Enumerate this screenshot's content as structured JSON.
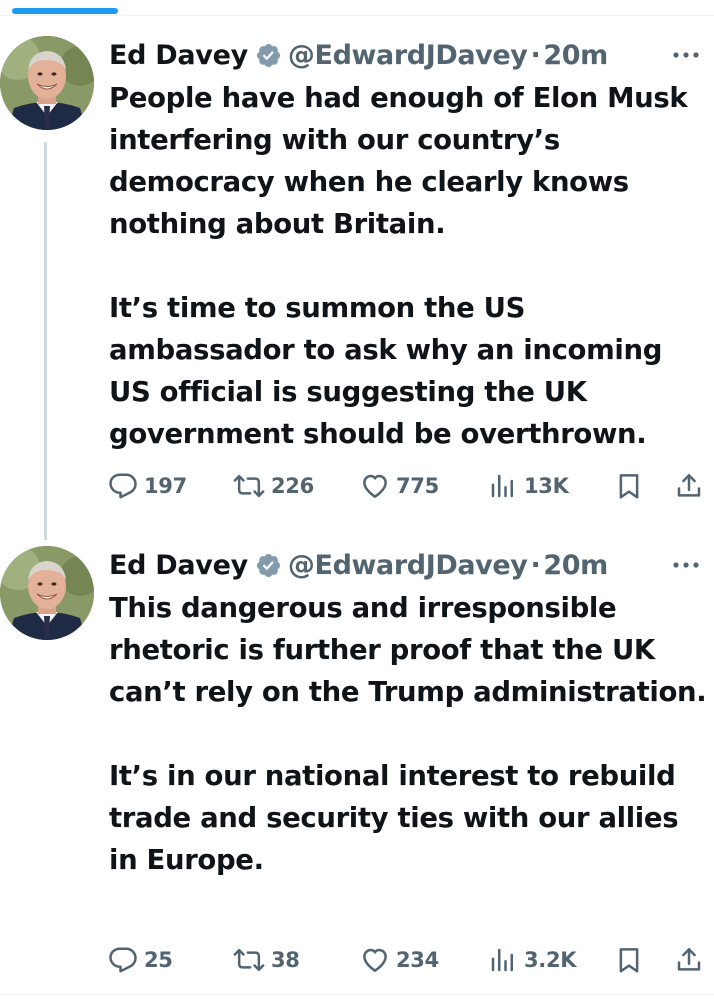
{
  "tweets": [
    {
      "author_name": "Ed Davey",
      "handle": "@EdwardJDavey",
      "separator": "·",
      "time": "20m",
      "paragraphs": [
        "People have had enough of Elon Musk interfering with our country’s democracy when he clearly knows nothing about Britain.",
        "It’s time to summon the US ambassador to ask why an incoming US official is suggesting the UK government should be overthrown."
      ],
      "stats": {
        "replies": "197",
        "reposts": "226",
        "likes": "775",
        "views": "13K"
      }
    },
    {
      "author_name": "Ed Davey",
      "handle": "@EdwardJDavey",
      "separator": "·",
      "time": "20m",
      "paragraphs": [
        "This dangerous and irresponsible rhetoric is further proof that the UK can’t rely on the Trump administration.",
        "It’s in our national interest to rebuild trade and security ties with our allies in Europe."
      ],
      "stats": {
        "replies": "25",
        "reposts": "38",
        "likes": "234",
        "views": "3.2K"
      }
    }
  ],
  "colors": {
    "accent": "#1d9bf0",
    "text": "#0f1419",
    "secondary_text": "#536471",
    "thread_line": "#cfd9de",
    "verified_badge": "#829aab"
  },
  "icons": {
    "verified": "verified-badge-icon",
    "more": "more-horizontal-icon",
    "reply": "reply-icon",
    "repost": "repost-icon",
    "like": "heart-icon",
    "views": "views-icon",
    "bookmark": "bookmark-icon",
    "share": "share-icon"
  }
}
